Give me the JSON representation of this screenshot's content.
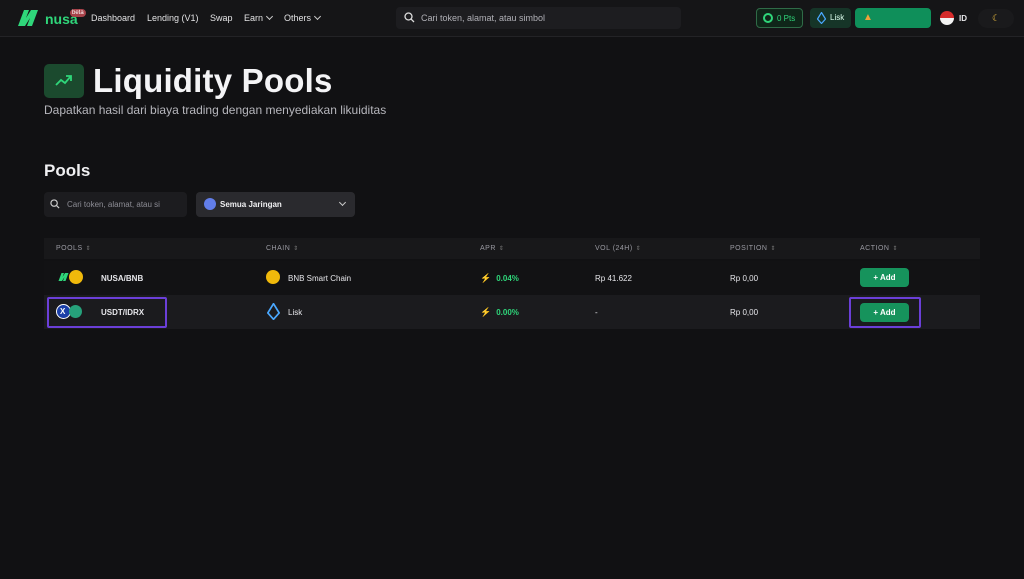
{
  "nav": {
    "brand": "nusa",
    "beta": "beta",
    "items": [
      "Dashboard",
      "Lending (V1)",
      "Swap",
      "Earn",
      "Others"
    ],
    "search_placeholder": "Cari token, alamat, atau simbol",
    "points": "0 Pts",
    "network": "Lisk",
    "language": "ID"
  },
  "header": {
    "title": "Liquidity Pools",
    "subtitle": "Dapatkan hasil dari biaya trading dengan menyediakan likuiditas"
  },
  "pools_section": {
    "title": "Pools",
    "search_placeholder": "Cari token, alamat, atau si",
    "network_filter": "Semua Jaringan"
  },
  "table": {
    "columns": [
      "POOLS",
      "CHAIN",
      "APR",
      "VOL (24H)",
      "POSITION",
      "ACTION"
    ],
    "rows": [
      {
        "pool": "NUSA/BNB",
        "chain": "BNB Smart Chain",
        "apr": "0.04%",
        "vol": "Rp 41.622",
        "position": "Rp 0,00",
        "action": "+ Add"
      },
      {
        "pool": "USDT/IDRX",
        "chain": "Lisk",
        "apr": "0.00%",
        "vol": "-",
        "position": "Rp 0,00",
        "action": "+ Add"
      }
    ]
  },
  "colors": {
    "accent": "#2fd67a",
    "button": "#16935c",
    "highlight": "#6b3fd8"
  }
}
